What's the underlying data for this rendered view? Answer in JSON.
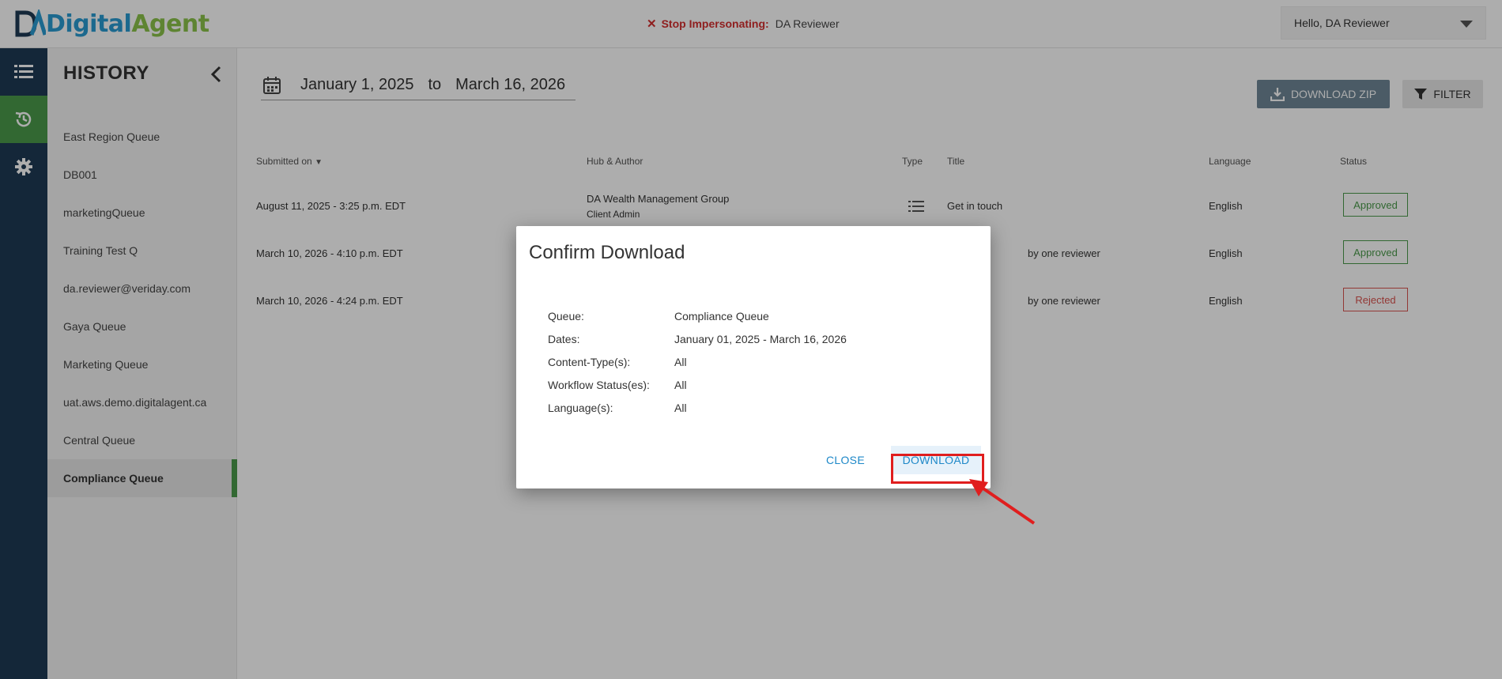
{
  "header": {
    "logo_part1": "Digital",
    "logo_part2": "Agent",
    "impersonate_stop": "Stop Impersonating:",
    "impersonate_user": "DA Reviewer",
    "hello": "Hello,  DA Reviewer"
  },
  "rail": {
    "items": [
      {
        "icon": "list-icon"
      },
      {
        "icon": "history-icon",
        "active": true
      },
      {
        "icon": "gear-icon"
      }
    ]
  },
  "sidebar": {
    "title": "HISTORY",
    "items": [
      {
        "label": "East Region Queue"
      },
      {
        "label": "DB001"
      },
      {
        "label": "marketingQueue"
      },
      {
        "label": "Training Test Q"
      },
      {
        "label": "da.reviewer@veriday.com"
      },
      {
        "label": "Gaya Queue"
      },
      {
        "label": "Marketing Queue"
      },
      {
        "label": "uat.aws.demo.digitalagent.ca"
      },
      {
        "label": "Central Queue"
      },
      {
        "label": "Compliance Queue",
        "active": true
      }
    ]
  },
  "main": {
    "date_from": "January 1, 2025",
    "date_to_label": "to",
    "date_to": "March 16, 2026",
    "download_zip_label": "DOWNLOAD ZIP",
    "filter_label": "FILTER",
    "columns": {
      "submitted": "Submitted on",
      "hub": "Hub & Author",
      "type": "Type",
      "title": "Title",
      "language": "Language",
      "status": "Status"
    },
    "rows": [
      {
        "submitted": "August 11, 2025 - 3:25 p.m. EDT",
        "hub": "DA Wealth Management Group",
        "author": "Client Admin",
        "title": "Get in touch",
        "language": "English",
        "status": "Approved"
      },
      {
        "submitted": "March 10, 2026 - 4:10 p.m. EDT",
        "hub": "",
        "author": "",
        "title": "by one reviewer",
        "language": "English",
        "status": "Approved"
      },
      {
        "submitted": "March 10, 2026 - 4:24 p.m. EDT",
        "hub": "",
        "author": "",
        "title": "by one reviewer",
        "language": "English",
        "status": "Rejected"
      }
    ]
  },
  "modal": {
    "title": "Confirm Download",
    "details": [
      {
        "label": "Queue:",
        "value": "Compliance Queue"
      },
      {
        "label": "Dates:",
        "value": "January 01, 2025 - March 16, 2026"
      },
      {
        "label": "Content-Type(s):",
        "value": "All"
      },
      {
        "label": "Workflow Status(es):",
        "value": "All"
      },
      {
        "label": "Language(s):",
        "value": "All"
      }
    ],
    "close_label": "CLOSE",
    "download_label": "DOWNLOAD"
  },
  "colors": {
    "rail": "#1e3a55",
    "accent_green": "#4a9a4a",
    "link_blue": "#1e88c8",
    "annotation_red": "#e01e1e"
  }
}
